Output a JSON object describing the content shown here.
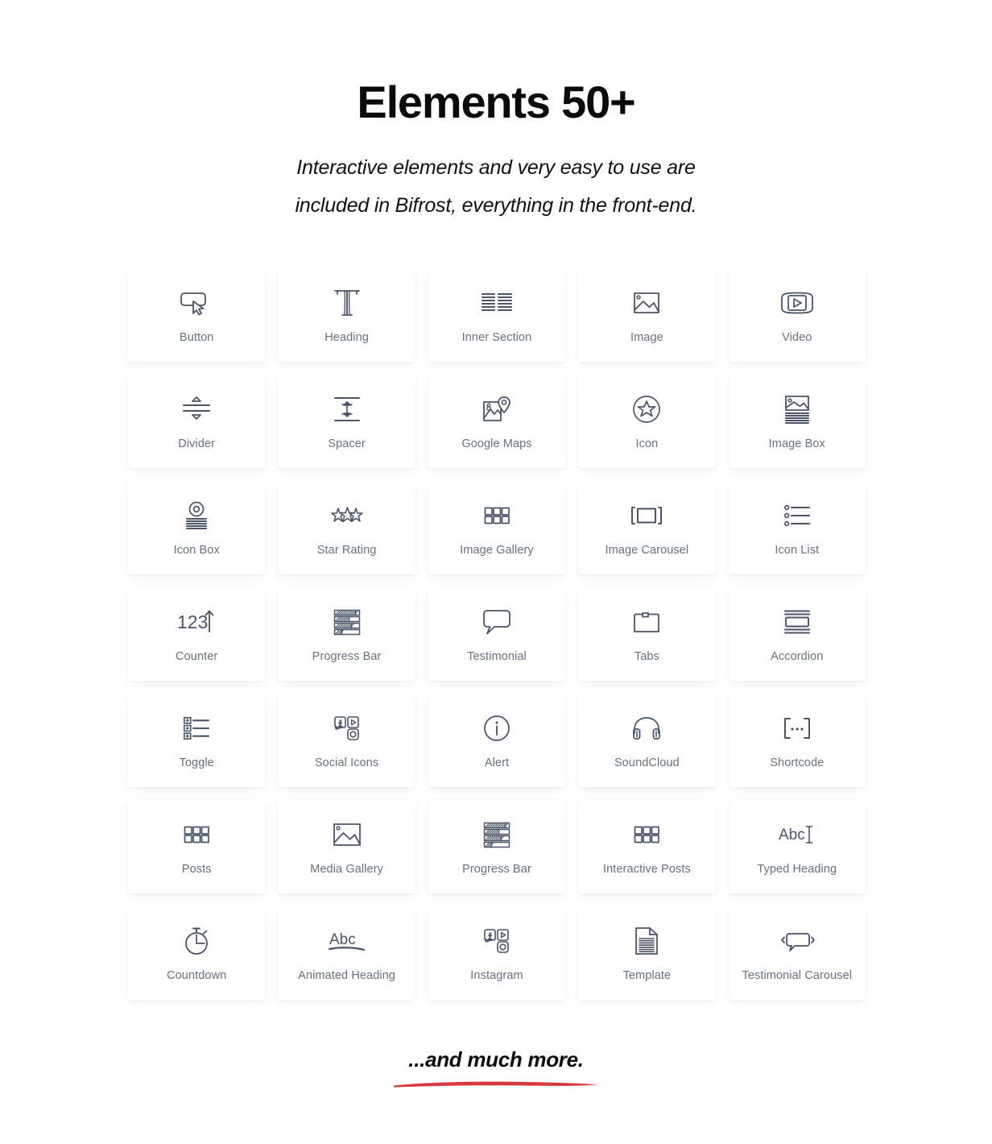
{
  "header": {
    "title": "Elements 50+",
    "subtitle_line1": "Interactive elements and very easy to use are",
    "subtitle_line2": "included in Bifrost, everything in the front-end."
  },
  "colors": {
    "page_background": "#ffffff",
    "card_background": "#ffffff",
    "icon_stroke": "#4a5568",
    "label_text": "#66717e",
    "heading_text": "#0b0b0b",
    "underline_accent": "#d8393c"
  },
  "grid": {
    "columns": 5,
    "rows": 7,
    "items": [
      {
        "label": "Button",
        "icon": "button-cursor-icon"
      },
      {
        "label": "Heading",
        "icon": "heading-t-icon"
      },
      {
        "label": "Inner Section",
        "icon": "inner-section-icon"
      },
      {
        "label": "Image",
        "icon": "image-icon"
      },
      {
        "label": "Video",
        "icon": "video-play-icon"
      },
      {
        "label": "Divider",
        "icon": "divider-icon"
      },
      {
        "label": "Spacer",
        "icon": "spacer-icon"
      },
      {
        "label": "Google Maps",
        "icon": "google-maps-pin-icon"
      },
      {
        "label": "Icon",
        "icon": "star-circle-icon"
      },
      {
        "label": "Image Box",
        "icon": "image-box-icon"
      },
      {
        "label": "Icon Box",
        "icon": "icon-box-icon"
      },
      {
        "label": "Star Rating",
        "icon": "star-rating-icon"
      },
      {
        "label": "Image Gallery",
        "icon": "image-gallery-grid-icon"
      },
      {
        "label": "Image Carousel",
        "icon": "image-carousel-icon"
      },
      {
        "label": "Icon List",
        "icon": "icon-list-icon"
      },
      {
        "label": "Counter",
        "icon": "counter-123-arrow-icon"
      },
      {
        "label": "Progress Bar",
        "icon": "progress-bar-icon"
      },
      {
        "label": "Testimonial",
        "icon": "speech-bubble-icon"
      },
      {
        "label": "Tabs",
        "icon": "tabs-folder-icon"
      },
      {
        "label": "Accordion",
        "icon": "accordion-icon"
      },
      {
        "label": "Toggle",
        "icon": "toggle-list-icon"
      },
      {
        "label": "Social Icons",
        "icon": "social-icons-icon"
      },
      {
        "label": "Alert",
        "icon": "info-circle-icon"
      },
      {
        "label": "SoundCloud",
        "icon": "headphones-icon"
      },
      {
        "label": "Shortcode",
        "icon": "shortcode-brackets-icon"
      },
      {
        "label": "Posts",
        "icon": "posts-grid-icon"
      },
      {
        "label": "Media Gallery",
        "icon": "media-gallery-image-icon"
      },
      {
        "label": "Progress Bar",
        "icon": "progress-bar-icon"
      },
      {
        "label": "Interactive Posts",
        "icon": "interactive-posts-grid-icon"
      },
      {
        "label": "Typed Heading",
        "icon": "typed-heading-abc-icon"
      },
      {
        "label": "Countdown",
        "icon": "stopwatch-icon"
      },
      {
        "label": "Animated Heading",
        "icon": "animated-heading-abc-icon"
      },
      {
        "label": "Instagram",
        "icon": "instagram-social-icon"
      },
      {
        "label": "Template",
        "icon": "template-document-icon"
      },
      {
        "label": "Testimonial Carousel",
        "icon": "testimonial-carousel-icon"
      }
    ]
  },
  "footer": {
    "text": "...and much more."
  }
}
